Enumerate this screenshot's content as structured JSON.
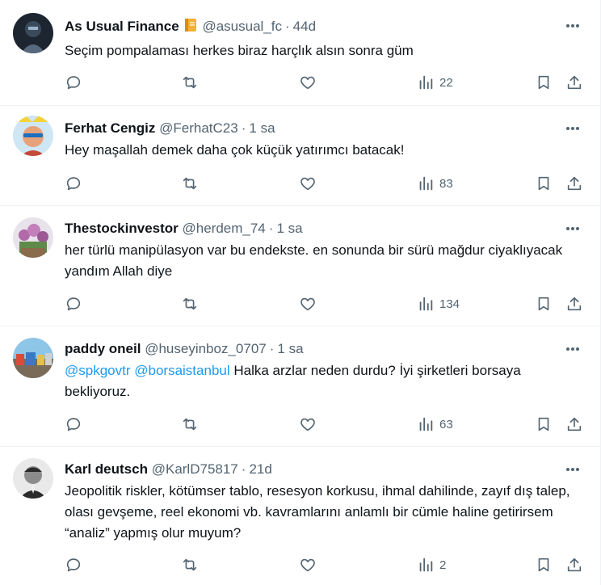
{
  "tweets": [
    {
      "name": "As Usual Finance",
      "badge": "notebook-badge",
      "handle": "@asusual_fc",
      "time": "44d",
      "mentions": [],
      "text": "Seçim pompalaması herkes biraz harçlık alsın sonra güm",
      "views": "22"
    },
    {
      "name": "Ferhat Cengiz",
      "handle": "@FerhatC23",
      "time": "1 sa",
      "mentions": [],
      "text": "Hey maşallah demek daha çok küçük yatırımcı batacak!",
      "views": "83"
    },
    {
      "name": "Thestockinvestor",
      "handle": "@herdem_74",
      "time": "1 sa",
      "mentions": [],
      "text": "her türlü manipülasyon var bu endekste. en sonunda bir sürü mağdur ciyaklıyacak yandım Allah diye",
      "views": "134"
    },
    {
      "name": "paddy oneil",
      "handle": "@huseyinboz_0707",
      "time": "1 sa",
      "mentions": [
        "@spkgovtr",
        "@borsaistanbul"
      ],
      "text": "Halka arzlar neden durdu? İyi şirketleri borsaya bekliyoruz.",
      "views": "63"
    },
    {
      "name": "Karl deutsch",
      "handle": "@KarlD75817",
      "time": "21d",
      "mentions": [],
      "text": "Jeopolitik riskler, kötümser tablo, resesyon korkusu, ihmal dahilinde, zayıf dış talep, olası gevşeme, reel ekonomi vb. kavramlarını anlamlı bir cümle haline getirirsem “analiz” yapmış olur muyum?",
      "views": "2"
    }
  ],
  "colors": {
    "text": "#0f1419",
    "muted": "#536471",
    "link": "#1d9bf0",
    "divider": "#eff3f4"
  },
  "icons": [
    "reply-icon",
    "retweet-icon",
    "like-icon",
    "views-icon",
    "bookmark-icon",
    "share-icon",
    "more-icon"
  ]
}
